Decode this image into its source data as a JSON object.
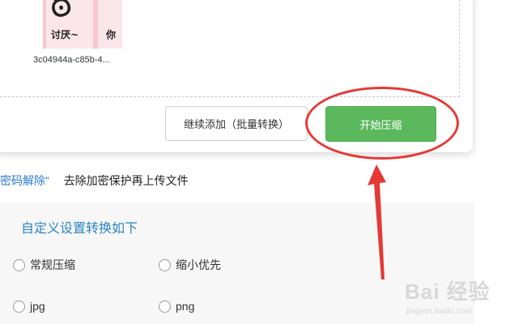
{
  "file": {
    "thumbnail_text_left": "讨厌~",
    "thumbnail_text_right": "你",
    "name": "3c04944a-c85b-4..."
  },
  "buttons": {
    "add_more": "继续添加（批量转换）",
    "start": "开始压缩"
  },
  "note": {
    "link": "密码解除”",
    "text": "去除加密保护再上传文件"
  },
  "settings": {
    "title": "自定义设置转换如下",
    "options": [
      "常规压缩",
      "缩小优先",
      "jpg",
      "png"
    ]
  },
  "watermark": {
    "brand": "Bai 经验",
    "url": "jingyan.baidu.com"
  },
  "colors": {
    "start_button": "#5cb85c",
    "highlight": "#e53935",
    "link": "#2b7cd3",
    "settings_title": "#2b86c5"
  }
}
